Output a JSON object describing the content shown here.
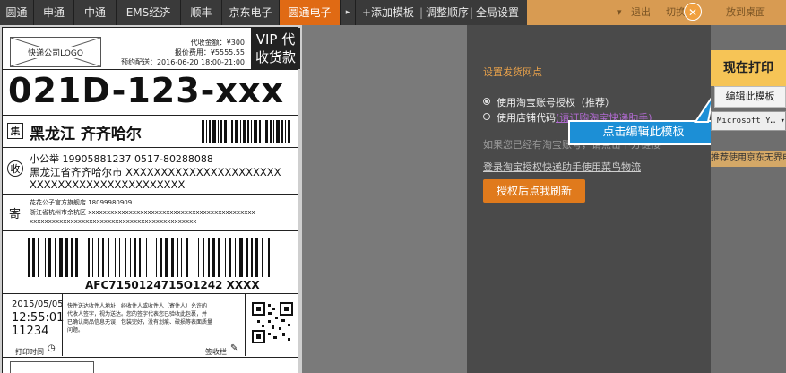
{
  "tabs": [
    "圆通",
    "申通",
    "中通",
    "EMS经济",
    "顺丰",
    "京东电子",
    "圆通电子"
  ],
  "active_tab": 6,
  "toolbar": {
    "add_template": "+添加模板",
    "sep": "|",
    "reorder": "调整顺序",
    "global_settings": "全局设置"
  },
  "topright": {
    "dropdown": "▾",
    "logout": "退出",
    "switch": "切换",
    "desktop": "放到桌面",
    "more": "▾"
  },
  "label": {
    "logo": "快递公司LOGO",
    "amount": "代收金额：¥300",
    "insured": "报价费用：¥5555.55",
    "appointment": "预约配送：2016-06-20 18:00-21:00",
    "vip_line1": "VIP 代",
    "vip_line2": "收货款",
    "big_code": "021D-123-xxx",
    "ji": "集",
    "dest_city": "黑龙江 齐齐哈尔",
    "shou": "收",
    "recv_name_phone": "小公举   19905881237    0517-80288088",
    "recv_addr1": "黑龙江省齐齐哈尔市 XXXXXXXXXXXXXXXXXXXXXX",
    "recv_addr2": "XXXXXXXXXXXXXXXXXXXXXX",
    "ji2": "寄",
    "sender_name": "花花公子官方旗舰店    18099980909",
    "sender_addr1": "浙江省杭州市余杭区 xxxxxxxxxxxxxxxxxxxxxxxxxxxxxxxxxxxxxxxxxxxxx",
    "sender_addr2": "xxxxxxxxxxxxxxxxxxxxxxxxxxxxxxxxxxxxxxxxxxxxx",
    "tracking": "AFC7150124715O1242 XXXX",
    "date": "2015/05/05",
    "time": "12:55:01",
    "num": "11234",
    "terms1": "快件送达收件人地址，经收件人或收件人（寄件人）允许的",
    "terms2": "代收人签字，视为送达。您的签字代表您已验收此包裹，并",
    "terms3": "已确认商品信息无误，包装完好，没有划痕、破损等表面质量",
    "terms4": "问题。",
    "print_time": "打印时间",
    "sign": "签收栏"
  },
  "panel": {
    "title": "设置发货网点",
    "opt1": "使用淘宝账号授权（推荐）",
    "opt2_prefix": "使用店铺代码",
    "opt2_link": "(请订购淘宝快递助手)",
    "note": "如果您已经有淘宝账号，请点击下方链接",
    "link": "登录淘宝授权快递助手使用菜鸟物流",
    "button": "授权后点我刷新"
  },
  "callout": "点击编辑此模板",
  "side": {
    "print_now": "现在打印",
    "edit_template": "编辑此模板",
    "font": "Microsoft Y…",
    "note": "推荐使用京东无界电"
  },
  "colors": {
    "accent": "#e06a14",
    "callout": "#1c8fd6",
    "print_btn": "#f6c456"
  }
}
